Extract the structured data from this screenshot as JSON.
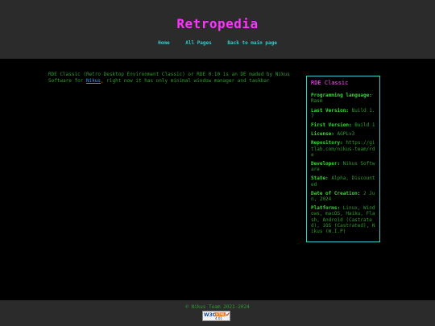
{
  "site": {
    "title": "Retropedia"
  },
  "nav": {
    "home": "Home",
    "all_pages": "All Pages",
    "back": "Back to main page"
  },
  "article": {
    "text_before": "RDE Classic (Retro Desktop Environment Classic) or RDE 0.10 is an DE maded by Nikus Software for ",
    "link": "Nikus",
    "text_after": ", right now it has only minimal window manager and taskbar"
  },
  "infobox": {
    "title": "RDE Classic",
    "fields": [
      {
        "label": "Programming language:",
        "value": "Rasm"
      },
      {
        "label": "Last Version:",
        "value": "Build 1.7"
      },
      {
        "label": "First Version:",
        "value": "Build 1"
      },
      {
        "label": "License:",
        "value": "AGPLv3"
      },
      {
        "label": "Repository:",
        "value": "https://gitlab.com/nikus-team/rde"
      },
      {
        "label": "Developer:",
        "value": "Nikus Software"
      },
      {
        "label": "State:",
        "value": "Alpha, Discounted"
      },
      {
        "label": "Date of Creation:",
        "value": "2 Jun, 2024"
      },
      {
        "label": "Platforms:",
        "value": "Linux, Windows, macOS, Haiku, Flash, Android (Castrated), iOS (Castrated), Nikus (W.I.P)"
      }
    ]
  },
  "footer": {
    "copyright": "© Nikus Team 2021-2024",
    "badge": {
      "w3c": "W3C",
      "html": "HTML",
      "version": "4.01"
    }
  }
}
